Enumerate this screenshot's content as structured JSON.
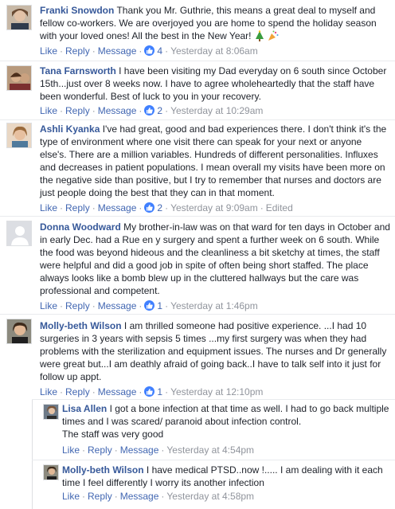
{
  "common": {
    "like": "Like",
    "reply": "Reply",
    "message": "Message",
    "dot": "·",
    "edited": "Edited"
  },
  "colors": {
    "link": "#4267b2",
    "name": "#365899",
    "meta": "#90949c",
    "like_badge": "#4080ff"
  },
  "comments": [
    {
      "name": "Franki Snowdon",
      "text": "Thank you Mr. Guthrie, this means a great deal to myself and fellow co-workers. We are overjoyed you are home to spend the holiday season with your loved ones! All the best in the New Year!",
      "emoji": [
        "christmas-tree-icon",
        "party-popper-icon"
      ],
      "likes": "4",
      "time": "Yesterday at 8:06am"
    },
    {
      "name": "Tana Farnsworth",
      "text": "I have been visiting my Dad everyday on 6 south since October 15th...just over 8 weeks now. I have to agree wholeheartedly that the staff have been wonderful. Best of luck to you in your recovery.",
      "likes": "2",
      "time": "Yesterday at 10:29am"
    },
    {
      "name": "Ashli Kyanka",
      "text": "I've had great, good and bad experiences there. I don't think it's the type of environment where one visit there can speak for your next or anyone else's. There are a million variables. Hundreds of different personalities. Influxes and decreases in patient populations. I mean overall my visits have been more on the negative side than positive, but I try to remember that nurses and doctors are just people doing the best that they can in that moment.",
      "likes": "2",
      "time": "Yesterday at 9:09am",
      "edited": true
    },
    {
      "name": "Donna Woodward",
      "text": "My brother-in-law was on that ward for ten days in October and in early Dec. had a Rue en y surgery and spent a further week on 6 south. While the food was beyond hideous and the cleanliness a bit sketchy at times, the staff were helpful and did a good job in spite of often being short staffed. The place always looks like a bomb blew up in the cluttered hallways but the care was professional and competent.",
      "likes": "1",
      "time": "Yesterday at 1:46pm"
    },
    {
      "name": "Molly-beth Wilson",
      "text": "I am thrilled someone had positive experience. ...I had 10 surgeries in 3 years with sepsis 5 times ...my first surgery was when they had problems with the sterilization and equipment issues. The nurses and Dr generally were great but...I am deathly afraid of going back..I have to talk self into it just for follow up appt.",
      "likes": "1",
      "time": "Yesterday at 12:10pm"
    }
  ],
  "replies": [
    {
      "name": "Lisa Allen",
      "text": "I got a bone infection at that time as well. I had to go back multiple times and I was scared/ paranoid about infection control.",
      "text2": "The staff was very good",
      "time": "Yesterday at 4:54pm"
    },
    {
      "name": "Molly-beth Wilson",
      "text": "I have medical PTSD..now !..... I am dealing with it each time I feel differently I worry its another infection",
      "time": "Yesterday at 4:58pm"
    }
  ]
}
